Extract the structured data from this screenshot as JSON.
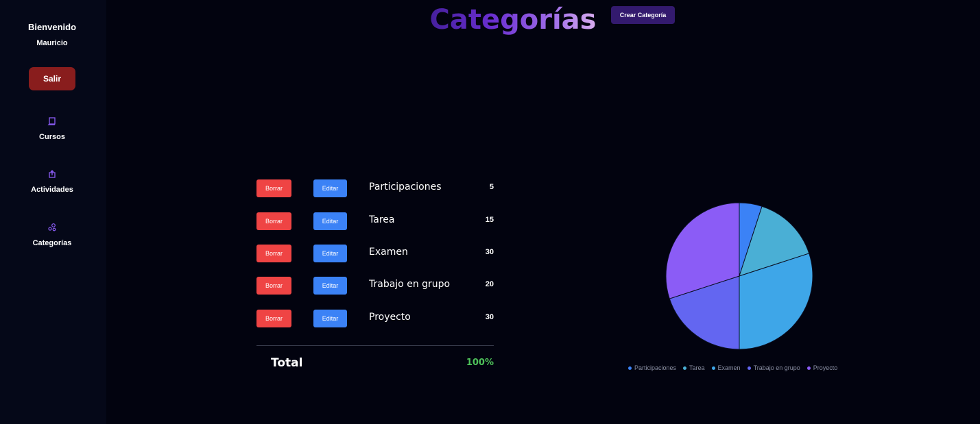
{
  "sidebar": {
    "welcome": "Bienvenido",
    "user": "Mauricio",
    "logout_label": "Salir",
    "items": [
      {
        "label": "Cursos",
        "icon": "book-icon"
      },
      {
        "label": "Actividades",
        "icon": "upload-icon"
      },
      {
        "label": "Categorías",
        "icon": "categories-icon"
      }
    ]
  },
  "header": {
    "title": "Categorías",
    "create_label": "Crear Categoría"
  },
  "buttons": {
    "delete_label": "Borrar",
    "edit_label": "Editar"
  },
  "categories": [
    {
      "name": "Participaciones",
      "value": "5"
    },
    {
      "name": "Tarea",
      "value": "15"
    },
    {
      "name": "Examen",
      "value": "30"
    },
    {
      "name": "Trabajo en grupo",
      "value": "20"
    },
    {
      "name": "Proyecto",
      "value": "30"
    }
  ],
  "total": {
    "label": "Total",
    "value": "100%"
  },
  "colors": {
    "accent": "#8b5cf6",
    "danger": "#ef4444",
    "primary": "#3b82f6",
    "success": "#4ec15a"
  },
  "chart_data": {
    "type": "pie",
    "categories": [
      "Participaciones",
      "Tarea",
      "Examen",
      "Trabajo en grupo",
      "Proyecto"
    ],
    "values": [
      5,
      15,
      30,
      20,
      30
    ],
    "colors": [
      "#3b82f6",
      "#4aafd5",
      "#3ea6e8",
      "#6366f1",
      "#8b5cf6"
    ],
    "legend": "bottom"
  }
}
